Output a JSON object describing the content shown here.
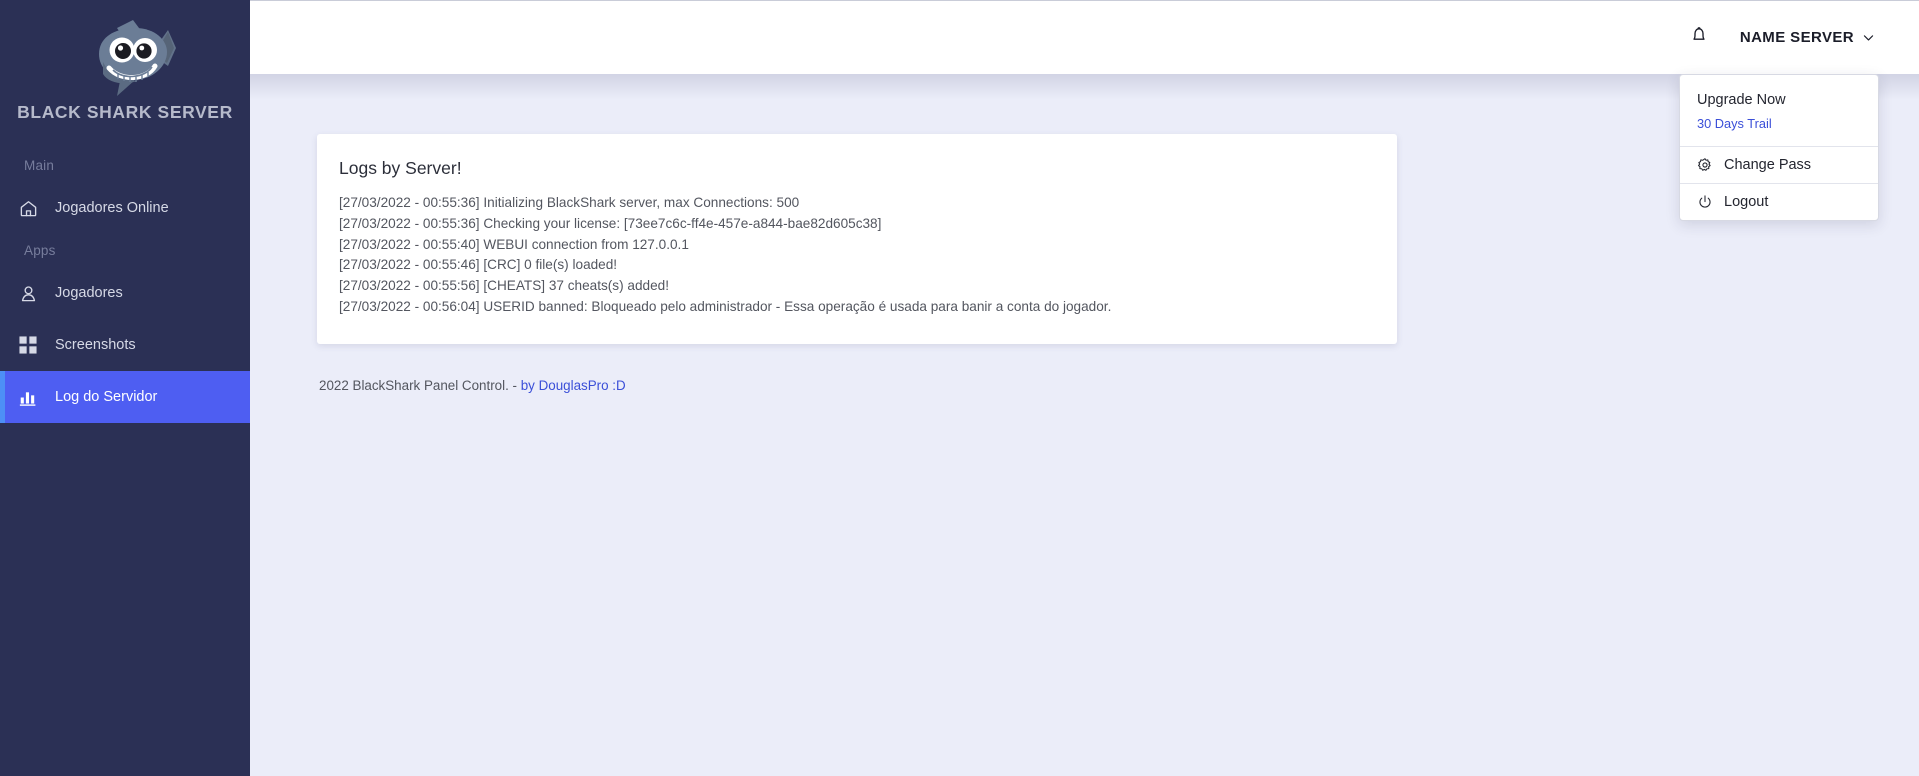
{
  "sidebar": {
    "brand": {
      "title": "BLACK SHARK SERVER",
      "logo_icon": "shark-logo-icon"
    },
    "groups": [
      {
        "label": "Main",
        "items": [
          {
            "label": "Jogadores Online",
            "icon": "home-icon",
            "active": false
          }
        ]
      },
      {
        "label": "Apps",
        "items": [
          {
            "label": "Jogadores",
            "icon": "user-icon",
            "active": false
          },
          {
            "label": "Screenshots",
            "icon": "grid-icon",
            "active": false
          },
          {
            "label": "Log do Servidor",
            "icon": "bar-chart-icon",
            "active": true
          }
        ]
      }
    ]
  },
  "topbar": {
    "bell_icon": "bell-icon",
    "user_label": "NAME SERVER",
    "chevron_icon": "chevron-down-icon"
  },
  "dropdown": {
    "upgrade_title": "Upgrade Now",
    "upgrade_link": "30 Days Trail",
    "items": [
      {
        "label": "Change Pass",
        "icon": "gear-icon"
      },
      {
        "label": "Logout",
        "icon": "power-icon"
      }
    ]
  },
  "card": {
    "title": "Logs by Server!",
    "lines": [
      "[27/03/2022 - 00:55:36] Initializing BlackShark server, max Connections: 500",
      "[27/03/2022 - 00:55:36] Checking your license: [73ee7c6c-ff4e-457e-a844-bae82d605c38]",
      "[27/03/2022 - 00:55:40] WEBUI connection from 127.0.0.1",
      "[27/03/2022 - 00:55:46] [CRC] 0 file(s) loaded!",
      "[27/03/2022 - 00:55:56] [CHEATS] 37 cheats(s) added!",
      "[27/03/2022 - 00:56:04] USERID banned: Bloqueado pelo administrador - Essa operação é usada para banir a conta do jogador."
    ]
  },
  "footer": {
    "text": "2022 BlackShark Panel Control. - ",
    "link": "by DouglasPro :D"
  },
  "colors": {
    "sidebar_bg": "#2b3055",
    "active_item": "#4e5ef2",
    "active_accent": "#4d8ff6",
    "page_bg": "#ebedf9",
    "link": "#3b4fd8"
  }
}
